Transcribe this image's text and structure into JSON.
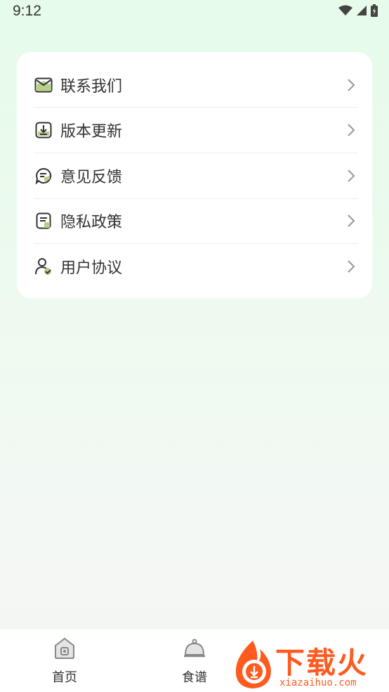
{
  "status": {
    "time": "9:12"
  },
  "menu": {
    "items": [
      {
        "label": "联系我们",
        "icon": "mail-icon"
      },
      {
        "label": "版本更新",
        "icon": "download-icon"
      },
      {
        "label": "意见反馈",
        "icon": "chat-feedback-icon"
      },
      {
        "label": "隐私政策",
        "icon": "document-icon"
      },
      {
        "label": "用户协议",
        "icon": "user-check-icon"
      }
    ]
  },
  "tabbar": {
    "tabs": [
      {
        "label": "首页",
        "icon": "home-icon"
      },
      {
        "label": "食谱",
        "icon": "cloche-icon"
      }
    ]
  },
  "watermark": {
    "text": "下载火",
    "url": "xiazaihuo.com"
  },
  "colors": {
    "accent": "#9cbf6a",
    "watermark": "#ff5a1f"
  }
}
